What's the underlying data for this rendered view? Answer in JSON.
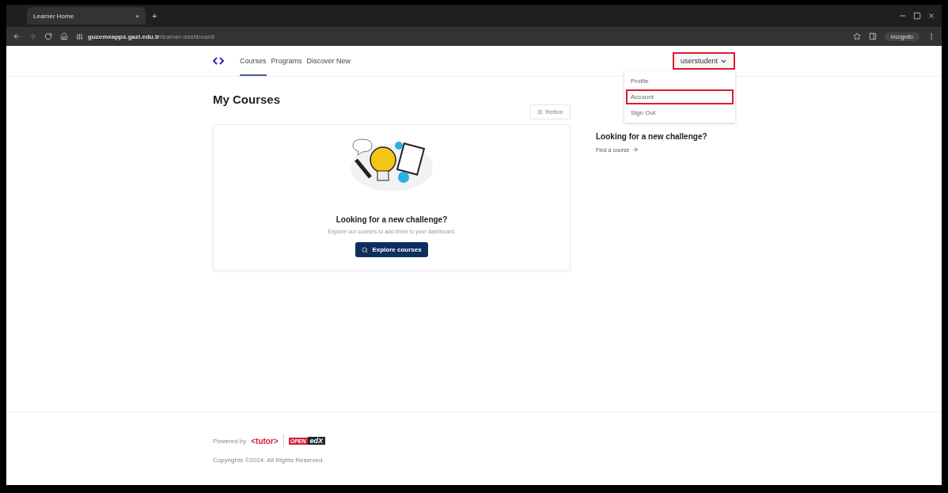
{
  "browser": {
    "tab": {
      "title": "Learner Home",
      "close": "×"
    },
    "new_tab": "+",
    "url_host": "guzemxapps.gazi.edu.tr",
    "url_path": "/learner-dashboard/",
    "incognito": "Incognito"
  },
  "header": {
    "nav": [
      {
        "label": "Courses",
        "selected": true
      },
      {
        "label": "Programs",
        "selected": false
      },
      {
        "label": "Discover New",
        "selected": false
      }
    ],
    "user": {
      "label": "userstudent",
      "highlighted": true
    },
    "menu": [
      {
        "label": "Profile",
        "highlighted": false
      },
      {
        "label": "Account",
        "highlighted": true
      },
      {
        "label": "Sign Out",
        "highlighted": false
      }
    ]
  },
  "main": {
    "title": "My Courses",
    "refine": "Refine",
    "empty": {
      "heading": "Looking for a new challenge?",
      "text": "Explore our courses to add them to your dashboard.",
      "button": "Explore courses"
    }
  },
  "sidebar": {
    "heading": "Looking for a new challenge?",
    "link": "Find a course"
  },
  "footer": {
    "powered_by": "Powered by",
    "tutor_logo": "<tutor>",
    "openedx_open": "OPEN",
    "openedx_edx": "edX",
    "copyright": "Copyrights ©2024. All Rights Reserved."
  }
}
